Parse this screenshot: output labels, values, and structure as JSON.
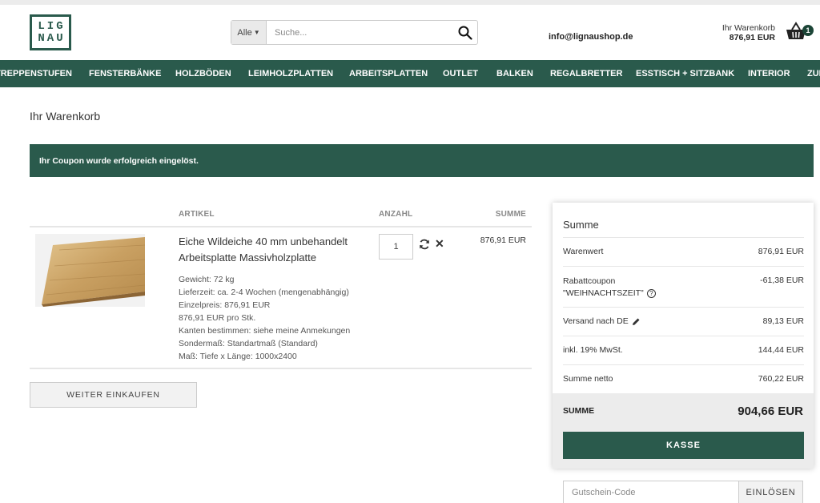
{
  "header": {
    "logo_line1": "LIG",
    "logo_line2": "NAU",
    "search_category": "Alle",
    "search_placeholder": "Suche...",
    "email": "info@lignaushop.de",
    "cart_label": "Ihr Warenkorb",
    "cart_total": "876,91 EUR",
    "cart_count": "1",
    "icons": {
      "search": "search-icon",
      "cart": "basket-icon"
    }
  },
  "nav": {
    "items": [
      "TREPPENSTUFEN",
      "FENSTERBÄNKE",
      "HOLZBÖDEN",
      "LEIMHOLZPLATTEN",
      "ARBEITSPLATTEN",
      "OUTLET",
      "BALKEN",
      "REGALBRETTER",
      "ESSTISCH + SITZBANK",
      "INTERIOR",
      "ZUBEHÖR"
    ]
  },
  "page": {
    "title": "Ihr Warenkorb",
    "alert": "Ihr Coupon wurde erfolgreich eingelöst."
  },
  "cart_table": {
    "headers": {
      "article": "ARTIKEL",
      "quantity": "ANZAHL",
      "sum": "SUMME"
    },
    "item": {
      "title": "Eiche Wildeiche 40 mm unbehandelt Arbeitsplatte Massivholzplatte",
      "details": [
        "Gewicht: 72 kg",
        "Lieferzeit: ca. 2-4 Wochen (mengenabhängig)",
        "Einzelpreis: 876,91 EUR",
        "876,91 EUR pro Stk.",
        "Kanten bestimmen: siehe meine Anmekungen",
        "Sondermaß: Standartmaß (Standard)",
        "Maß: Tiefe x Länge: 1000x2400"
      ],
      "quantity": "1",
      "sum": "876,91 EUR",
      "icons": {
        "refresh": "refresh-icon",
        "remove": "remove-icon"
      }
    }
  },
  "continue_label": "WEITER EINKAUFEN",
  "summary": {
    "title": "Summe",
    "rows": [
      {
        "label": "Warenwert",
        "value": "876,91 EUR"
      },
      {
        "label": "Rabattcoupon",
        "label2": "\"WEIHNACHTSZEIT\"",
        "value": "-61,38 EUR"
      },
      {
        "label": "Versand nach DE",
        "value": "89,13 EUR"
      },
      {
        "label": "inkl. 19% MwSt.",
        "value": "144,44 EUR"
      },
      {
        "label": "Summe netto",
        "value": "760,22 EUR"
      }
    ],
    "total_label": "SUMME",
    "total_value": "904,66 EUR",
    "checkout_label": "KASSE"
  },
  "coupon": {
    "placeholder": "Gutschein-Code",
    "button": "EINLÖSEN"
  },
  "colors": {
    "brand_green": "#2a5a4c",
    "badge": "#1c4537"
  }
}
